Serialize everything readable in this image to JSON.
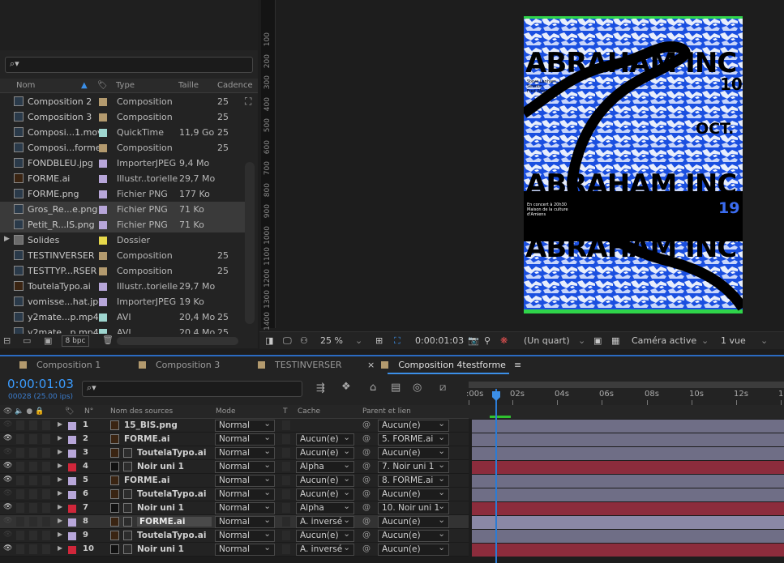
{
  "project": {
    "search_icon": "search-icon",
    "columns": {
      "name": "Nom",
      "type": "Type",
      "size": "Taille",
      "cadence": "Cadence"
    },
    "items": [
      {
        "name": "Composition 2",
        "type": "Composition",
        "size": "",
        "cadence": "25",
        "color": "#b39a6e",
        "kind": "comp",
        "selected": false
      },
      {
        "name": "Composition 3",
        "type": "Composition",
        "size": "",
        "cadence": "25",
        "color": "#b39a6e",
        "kind": "comp",
        "selected": false
      },
      {
        "name": "Composi...1.mov",
        "type": "QuickTime",
        "size": "11,9 Go",
        "cadence": "25",
        "color": "#9ed5cf",
        "kind": "movie",
        "selected": false
      },
      {
        "name": "Composi...forme",
        "type": "Composition",
        "size": "",
        "cadence": "25",
        "color": "#b39a6e",
        "kind": "comp",
        "selected": false
      },
      {
        "name": "FONDBLEU.jpg",
        "type": "ImporterJPEG",
        "size": "9,4 Mo",
        "cadence": "",
        "color": "#b7a6d9",
        "kind": "image",
        "selected": false
      },
      {
        "name": "FORME.ai",
        "type": "Illustr..torielle",
        "size": "29,7 Mo",
        "cadence": "",
        "color": "#b7a6d9",
        "kind": "ai",
        "selected": false
      },
      {
        "name": "FORME.png",
        "type": "Fichier PNG",
        "size": "177 Ko",
        "cadence": "",
        "color": "#b7a6d9",
        "kind": "image",
        "selected": false
      },
      {
        "name": "Gros_Re...e.png",
        "type": "Fichier PNG",
        "size": "71 Ko",
        "cadence": "",
        "color": "#b7a6d9",
        "kind": "image",
        "selected": true
      },
      {
        "name": "Petit_R...IS.png",
        "type": "Fichier PNG",
        "size": "71 Ko",
        "cadence": "",
        "color": "#b7a6d9",
        "kind": "image",
        "selected": true
      },
      {
        "name": "Solides",
        "type": "Dossier",
        "size": "",
        "cadence": "",
        "color": "#e6d84a",
        "kind": "folder",
        "selected": false
      },
      {
        "name": "TESTINVERSER",
        "type": "Composition",
        "size": "",
        "cadence": "25",
        "color": "#b39a6e",
        "kind": "comp",
        "selected": false
      },
      {
        "name": "TESTTYP...RSER",
        "type": "Composition",
        "size": "",
        "cadence": "25",
        "color": "#b39a6e",
        "kind": "comp",
        "selected": false
      },
      {
        "name": "ToutelaTypo.ai",
        "type": "Illustr..torielle",
        "size": "29,7 Mo",
        "cadence": "",
        "color": "#b7a6d9",
        "kind": "ai",
        "selected": false
      },
      {
        "name": "vomisse...hat.jpg",
        "type": "ImporterJPEG",
        "size": "19 Ko",
        "cadence": "",
        "color": "#b7a6d9",
        "kind": "image",
        "selected": false
      },
      {
        "name": "y2mate...p.mp4",
        "type": "AVI",
        "size": "20,4 Mo",
        "cadence": "25",
        "color": "#9ed5cf",
        "kind": "movie",
        "selected": false
      },
      {
        "name": "y2mate...p.mp4",
        "type": "AVI",
        "size": "20,4 Mo",
        "cadence": "25",
        "color": "#9ed5cf",
        "kind": "movie",
        "selected": false
      }
    ],
    "bpc": "8 bpc"
  },
  "viewer": {
    "ruler_labels": [
      "100",
      "200",
      "300",
      "400",
      "500",
      "600",
      "700",
      "800",
      "900",
      "1000",
      "1100",
      "1200",
      "1300",
      "1400"
    ],
    "zoom": "25 %",
    "time": "0:00:01:03",
    "resolution": "(Un quart)",
    "camera": "Caméra active",
    "views": "1 vue",
    "poster": {
      "title": "ABRAHAM INC",
      "day": "10",
      "month": "OCT.",
      "year": "19",
      "credits": "Steve Lanham\nSession\nFred Wesley",
      "event": "En concert à 20h30\nMaison de la culture\nd'Amiens"
    }
  },
  "tabs": [
    {
      "label": "Composition 1",
      "color": "#b39a6e",
      "active": false,
      "close": false
    },
    {
      "label": "Composition 3",
      "color": "#b39a6e",
      "active": false,
      "close": false
    },
    {
      "label": "TESTINVERSER",
      "color": "#b39a6e",
      "active": false,
      "close": false
    },
    {
      "label": "Composition 4testforme",
      "color": "#b39a6e",
      "active": true,
      "close": true
    }
  ],
  "timeline": {
    "timecode": "0:00:01:03",
    "frames": "00028 (25.00 ips)",
    "columns": {
      "num": "N°",
      "source": "Nom des sources",
      "mode": "Mode",
      "t": "T",
      "cache": "Cache",
      "parent": "Parent et lien"
    },
    "ruler": [
      ":00s",
      "02s",
      "04s",
      "06s",
      "08s",
      "10s",
      "12s",
      "1"
    ],
    "layers": [
      {
        "num": "1",
        "name": "15_BIS.png",
        "mode": "Normal",
        "cache": "",
        "parent": "Aucun(e)",
        "color": "#b7a6d9",
        "eye": false,
        "kind": "image",
        "indent": false,
        "bar": "#6f6e86",
        "selected": false
      },
      {
        "num": "2",
        "name": "FORME.ai",
        "mode": "Normal",
        "cache": "Aucun(e)",
        "parent": "5. FORME.ai",
        "color": "#b7a6d9",
        "eye": true,
        "kind": "ai",
        "indent": false,
        "bar": "#6f6e86",
        "selected": false
      },
      {
        "num": "3",
        "name": "ToutelaTypo.ai",
        "mode": "Normal",
        "cache": "Aucun(e)",
        "parent": "Aucun(e)",
        "color": "#b7a6d9",
        "eye": false,
        "kind": "ai",
        "indent": true,
        "bar": "#6f6e86",
        "selected": false
      },
      {
        "num": "4",
        "name": "Noir uni 1",
        "mode": "Normal",
        "cache": "Alpha",
        "parent": "7. Noir uni 1",
        "color": "#d0263a",
        "eye": true,
        "kind": "solid",
        "indent": true,
        "bar": "#8c2c3c",
        "selected": false
      },
      {
        "num": "5",
        "name": "FORME.ai",
        "mode": "Normal",
        "cache": "Aucun(e)",
        "parent": "8. FORME.ai",
        "color": "#b7a6d9",
        "eye": true,
        "kind": "ai",
        "indent": false,
        "bar": "#6f6e86",
        "selected": false
      },
      {
        "num": "6",
        "name": "ToutelaTypo.ai",
        "mode": "Normal",
        "cache": "Aucun(e)",
        "parent": "Aucun(e)",
        "color": "#b7a6d9",
        "eye": false,
        "kind": "ai",
        "indent": true,
        "bar": "#6f6e86",
        "selected": false
      },
      {
        "num": "7",
        "name": "Noir uni 1",
        "mode": "Normal",
        "cache": "Alpha",
        "parent": "10. Noir uni 1",
        "color": "#d0263a",
        "eye": true,
        "kind": "solid",
        "indent": true,
        "bar": "#8c2c3c",
        "selected": false
      },
      {
        "num": "8",
        "name": "FORME.ai",
        "mode": "Normal",
        "cache": "A. inversé",
        "parent": "Aucun(e)",
        "color": "#b7a6d9",
        "eye": false,
        "kind": "ai",
        "indent": true,
        "bar": "#8a88a6",
        "selected": true
      },
      {
        "num": "9",
        "name": "ToutelaTypo.ai",
        "mode": "Normal",
        "cache": "Aucun(e)",
        "parent": "Aucun(e)",
        "color": "#b7a6d9",
        "eye": false,
        "kind": "ai",
        "indent": true,
        "bar": "#6f6e86",
        "selected": false
      },
      {
        "num": "10",
        "name": "Noir uni 1",
        "mode": "Normal",
        "cache": "A. inversé",
        "parent": "Aucun(e)",
        "color": "#d0263a",
        "eye": true,
        "kind": "solid",
        "indent": true,
        "bar": "#8c2c3c",
        "selected": false
      }
    ]
  }
}
